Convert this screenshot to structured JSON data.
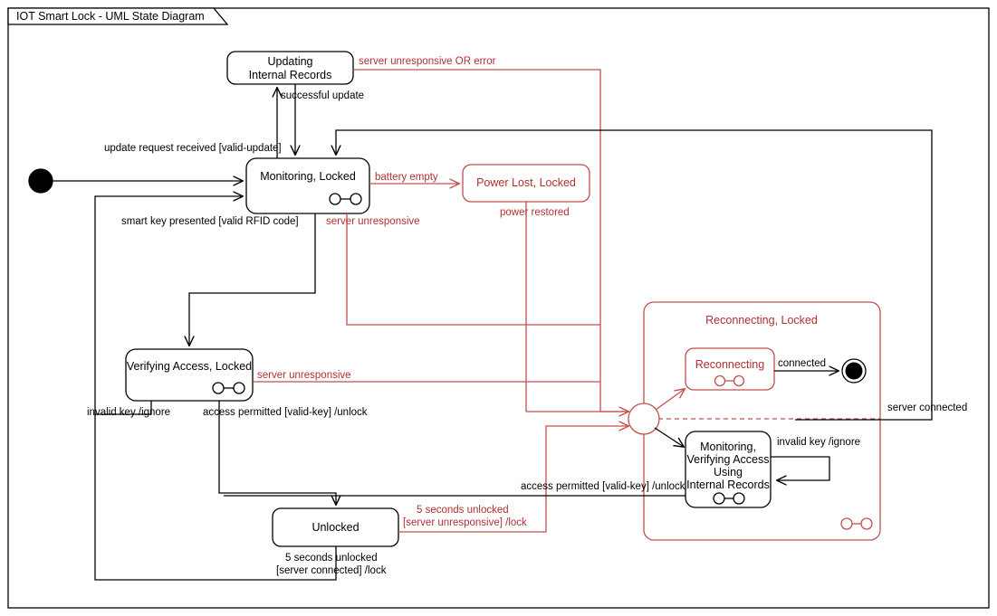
{
  "frame": {
    "title": "IOT Smart Lock - UML State Diagram"
  },
  "states": {
    "updating_internal_records": {
      "line1": "Updating",
      "line2": "Internal Records"
    },
    "monitoring_locked": {
      "label": "Monitoring, Locked"
    },
    "power_lost_locked": {
      "label": "Power Lost, Locked"
    },
    "verifying_access_locked": {
      "label": "Verifying Access, Locked"
    },
    "unlocked": {
      "label": "Unlocked"
    },
    "reconnecting_locked_composite": {
      "label": "Reconnecting, Locked"
    },
    "reconnecting": {
      "label": "Reconnecting"
    },
    "monitoring_verifying_internal": {
      "line1": "Monitoring,",
      "line2": "Verifying Access",
      "line3": "Using",
      "line4": "Internal Records"
    }
  },
  "transitions": {
    "server_unresponsive_or_error": "server unresponsive OR error",
    "successful_update": "successful update",
    "update_request_received": "update request received [valid-update]",
    "battery_empty": "battery empty",
    "power_restored": "power restored",
    "server_unresponsive_monitoring": "server unresponsive",
    "smart_key_presented": "smart key presented [valid RFID code]",
    "server_unresponsive_verifying": "server unresponsive",
    "invalid_key_ignore_left": "invalid key /ignore",
    "access_permitted_unlock_left": "access permitted [valid-key] /unlock",
    "five_seconds_unresponsive_l1": "5 seconds unlocked",
    "five_seconds_unresponsive_l2": "[server unresponsive] /lock",
    "five_seconds_connected_l1": "5 seconds unlocked",
    "five_seconds_connected_l2": "[server connected] /lock",
    "access_permitted_unlock_right": "access permitted [valid-key] /unlock",
    "connected": "connected",
    "invalid_key_ignore_right": "invalid key /ignore",
    "server_connected": "server connected"
  },
  "colors": {
    "black": "#000000",
    "red": "#c0504d",
    "red_text": "#b03030",
    "white": "#ffffff"
  }
}
